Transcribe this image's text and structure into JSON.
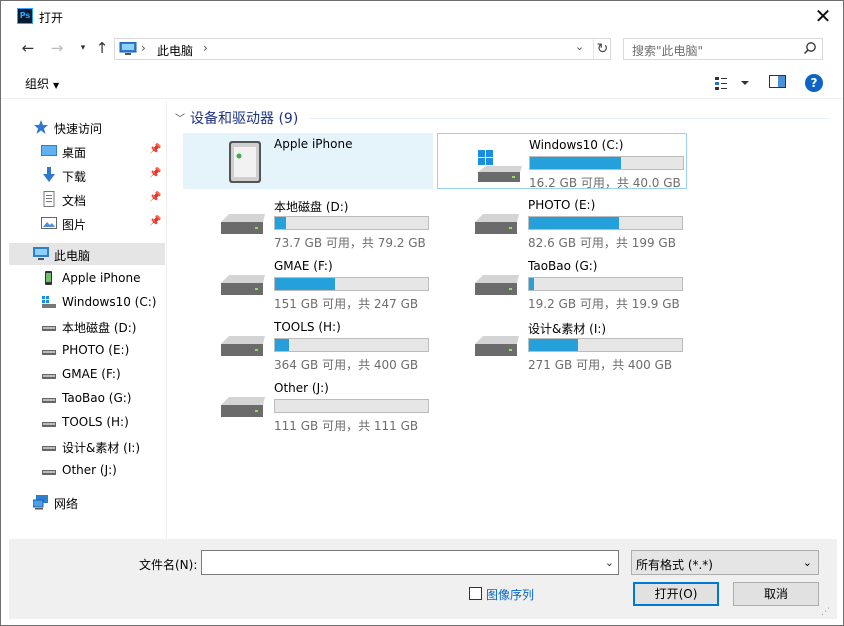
{
  "window": {
    "title": "打开",
    "app_icon": "Ps"
  },
  "nav": {
    "breadcrumb": "此电脑",
    "search_placeholder": "搜索\"此电脑\""
  },
  "toolbar": {
    "organize": "组织"
  },
  "sidebar": {
    "items": [
      {
        "label": "快速访问",
        "icon": "star-icon"
      },
      {
        "label": "桌面",
        "icon": "desktop-icon",
        "pinned": true
      },
      {
        "label": "下载",
        "icon": "download-icon",
        "pinned": true
      },
      {
        "label": "文档",
        "icon": "document-icon",
        "pinned": true
      },
      {
        "label": "图片",
        "icon": "picture-icon",
        "pinned": true
      },
      {
        "label": "此电脑",
        "icon": "computer-icon",
        "selected": true
      },
      {
        "label": "Apple iPhone",
        "icon": "phone-icon"
      },
      {
        "label": "Windows10 (C:)",
        "icon": "windows-drive-icon"
      },
      {
        "label": "本地磁盘 (D:)",
        "icon": "drive-icon"
      },
      {
        "label": "PHOTO (E:)",
        "icon": "drive-icon"
      },
      {
        "label": "GMAE (F:)",
        "icon": "drive-icon"
      },
      {
        "label": "TaoBao (G:)",
        "icon": "drive-icon"
      },
      {
        "label": "TOOLS (H:)",
        "icon": "drive-icon"
      },
      {
        "label": "设计&素材 (I:)",
        "icon": "drive-icon"
      },
      {
        "label": "Other (J:)",
        "icon": "drive-icon"
      },
      {
        "label": "网络",
        "icon": "network-icon"
      }
    ]
  },
  "content": {
    "group_title": "设备和驱动器 (9)",
    "devices": [
      {
        "name": "Apple iPhone",
        "type": "phone"
      },
      {
        "name": "Windows10 (C:)",
        "info": "16.2 GB 可用，共 40.0 GB",
        "used": 0.595,
        "type": "windows"
      },
      {
        "name": "本地磁盘 (D:)",
        "info": "73.7 GB 可用，共 79.2 GB",
        "used": 0.069,
        "type": "drive"
      },
      {
        "name": "PHOTO (E:)",
        "info": "82.6 GB 可用，共 199 GB",
        "used": 0.585,
        "type": "drive"
      },
      {
        "name": "GMAE (F:)",
        "info": "151 GB 可用，共 247 GB",
        "used": 0.389,
        "type": "drive"
      },
      {
        "name": "TaoBao (G:)",
        "info": "19.2 GB 可用，共 19.9 GB",
        "used": 0.035,
        "type": "drive"
      },
      {
        "name": "TOOLS (H:)",
        "info": "364 GB 可用，共 400 GB",
        "used": 0.09,
        "type": "drive"
      },
      {
        "name": "设计&素材 (I:)",
        "info": "271 GB 可用，共 400 GB",
        "used": 0.3225,
        "type": "drive"
      },
      {
        "name": "Other (J:)",
        "info": "111 GB 可用，共 111 GB",
        "used": 0.0,
        "type": "drive"
      }
    ]
  },
  "footer": {
    "filename_label": "文件名(N):",
    "filename_value": "",
    "filetype_value": "所有格式 (*.*)",
    "sequence_label": "图像序列",
    "open_label": "打开(O)",
    "cancel_label": "取消"
  },
  "colors": {
    "bar_fill": "#26a0da",
    "selected": "#e5e5e5",
    "accent": "#0078d7"
  }
}
